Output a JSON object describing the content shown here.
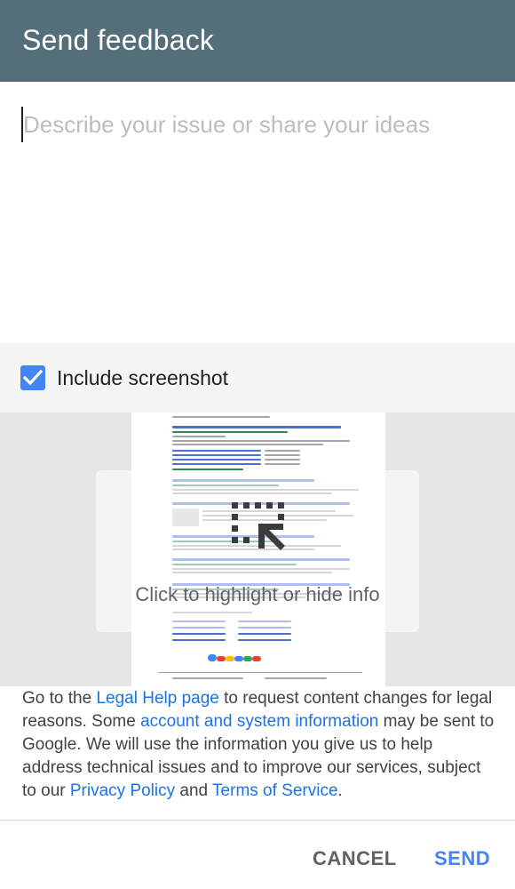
{
  "header": {
    "title": "Send feedback"
  },
  "description": {
    "placeholder": "Describe your issue or share your ideas",
    "value": ""
  },
  "screenshot_option": {
    "label": "Include screenshot",
    "checked": true
  },
  "screenshot_preview": {
    "hint": "Click to highlight or hide info"
  },
  "legal": {
    "t1": "Go to the ",
    "legal_help_link": "Legal Help page",
    "t2": " to request content changes for legal reasons. Some ",
    "account_info_link": "account and system information",
    "t3": " may be sent to Google. We will use the information you give us to help address technical issues and to improve our services, subject to our ",
    "privacy_link": "Privacy Policy",
    "t4": " and ",
    "terms_link": "Terms of Service",
    "t5": "."
  },
  "footer": {
    "cancel_label": "CANCEL",
    "send_label": "SEND"
  },
  "colors": {
    "header": "#546e7a",
    "accent": "#4285f4",
    "link": "#1a73e8"
  }
}
